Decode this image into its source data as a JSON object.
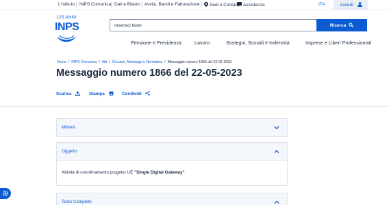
{
  "topbar": {
    "links": [
      "L'Istituto",
      "INPS Comunica",
      "Dati e Bilanci",
      "Avvisi, Bandi e Fatturazione",
      "Sedi e Contatti",
      "Assistenza"
    ],
    "language": "ITA",
    "login_label": "Accedi"
  },
  "header": {
    "logo_anni": "125 ANNI",
    "logo_name": "INPS",
    "search_value": "Inserisci testo",
    "search_button_label": "Ricerca"
  },
  "nav": {
    "items": [
      "Pensione e Previdenza",
      "Lavoro",
      "Sostegni, Sussidi e Indennità",
      "Imprese e Liberi Professionisti"
    ]
  },
  "breadcrumb": [
    "Home",
    "INPS Comunica",
    "Atti",
    "Circolari, Messaggi e Normativa",
    "Messaggio numero 1866 del 22-05-2023"
  ],
  "page": {
    "title": "Messaggio numero 1866 del 22-05-2023",
    "actions": {
      "download_label": "Scarica",
      "print_label": "Stampa",
      "share_label": "Condividi"
    }
  },
  "sections": {
    "mittenti_title": "Mittenti",
    "oggetto_title": "Oggetto",
    "oggetto_body_prefix": "Attività di coordinamento progetto UE ",
    "oggetto_body_bold": "\"Single Digital Gateway\"",
    "testo_title": "Testo Completo"
  },
  "colors": {
    "primary": "#0b5bd3",
    "text": "#1b2a41",
    "panel": "#f3f6fb"
  }
}
